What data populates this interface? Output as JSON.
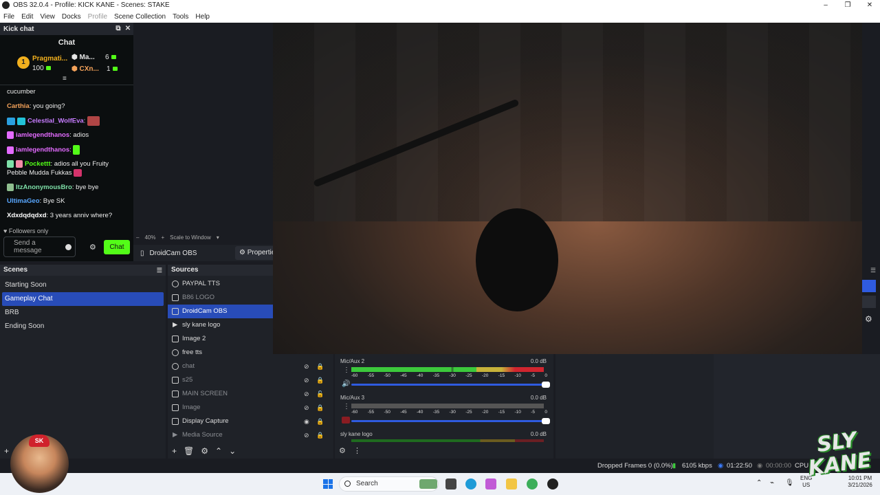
{
  "window": {
    "title": "OBS 32.0.4 - Profile: KICK KANE - Scenes: STAKE",
    "controls": [
      "–",
      "❐",
      "✕"
    ]
  },
  "menu": {
    "items": [
      "File",
      "Edit",
      "View",
      "Docks",
      "Profile",
      "Scene Collection",
      "Tools",
      "Help"
    ]
  },
  "chat_dock": {
    "dock_title": "Kick chat",
    "panel_title": "Chat",
    "leaders": [
      {
        "rank": "1",
        "name": "Pragmati...",
        "value": "100"
      },
      {
        "name": "Ma...",
        "value": "6"
      },
      {
        "name": "CXn...",
        "value": "1"
      }
    ],
    "messages": [
      {
        "user": "",
        "text": "cucumber"
      },
      {
        "user": "Carthia",
        "text": ": you going?"
      },
      {
        "user": "Celestial_WolfEva",
        "text": ":"
      },
      {
        "user": "iamlegendthanos",
        "text": ": adios"
      },
      {
        "user": "iamlegendthanos",
        "text": ":"
      },
      {
        "user": "Pockettt",
        "text": ": adios all you Fruity Pebble Mudda Fukkas"
      },
      {
        "user": "ItzAnonymousBro",
        "text": ": bye bye"
      },
      {
        "user": "UltimaGeo",
        "text": ": Bye SK"
      },
      {
        "user": "Xdxdqdqdxd",
        "text": ": 3 years anniv where?"
      }
    ],
    "followers_only": "Followers only",
    "input_placeholder": "Send a message",
    "send_label": "Chat",
    "colors": {
      "kick_green": "#53fc18",
      "carthia": "#f4a25a",
      "celestial": "#c77dff",
      "iamlegend": "#e36bff",
      "pockettt": "#53fc18",
      "itzanon": "#7ee0a8",
      "ultimageo": "#59a7ff",
      "xdxd": "#ffffff"
    }
  },
  "preview": {
    "zoom": "40%",
    "scale_mode": "Scale to Window",
    "selected_source": "DroidCam OBS",
    "properties_label": "Properties"
  },
  "scenes": {
    "title": "Scenes",
    "items": [
      "Starting Soon",
      "Gameplay Chat",
      "BRB",
      "Ending Soon"
    ],
    "selected_index": 1
  },
  "sources": {
    "title": "Sources",
    "items": [
      "PAYPAL TTS",
      "B86 LOGO",
      "DroidCam OBS",
      "sly kane logo",
      "Image 2",
      "free tts",
      "chat",
      "s25",
      "MAIN SCREEN",
      "Image",
      "Display Capture",
      "Media Source"
    ]
  },
  "mixer": {
    "tracks": [
      {
        "name": "Mic/Aux 2",
        "db": "0.0 dB"
      },
      {
        "name": "Mic/Aux 3",
        "db": "0.0 dB"
      },
      {
        "name": "sly kane logo",
        "db": "0.0 dB"
      }
    ],
    "scale": [
      "-60",
      "-55",
      "-50",
      "-45",
      "-40",
      "-35",
      "-30",
      "-25",
      "-20",
      "-15",
      "-10",
      "-5",
      "0"
    ]
  },
  "status": {
    "dropped_frames": "Dropped Frames 0 (0.0%)",
    "bitrate": "6105 kbps",
    "stream_time": "01:22:50",
    "record_time": "00:00:00",
    "cpu": "CPU"
  },
  "taskbar": {
    "search": "Search",
    "lang": "ENG",
    "region": "US",
    "time": "10:01 PM",
    "date": "3/21/2026"
  },
  "overlay": {
    "avatar_cap": "SK",
    "logo_text": "SLY KANE"
  }
}
